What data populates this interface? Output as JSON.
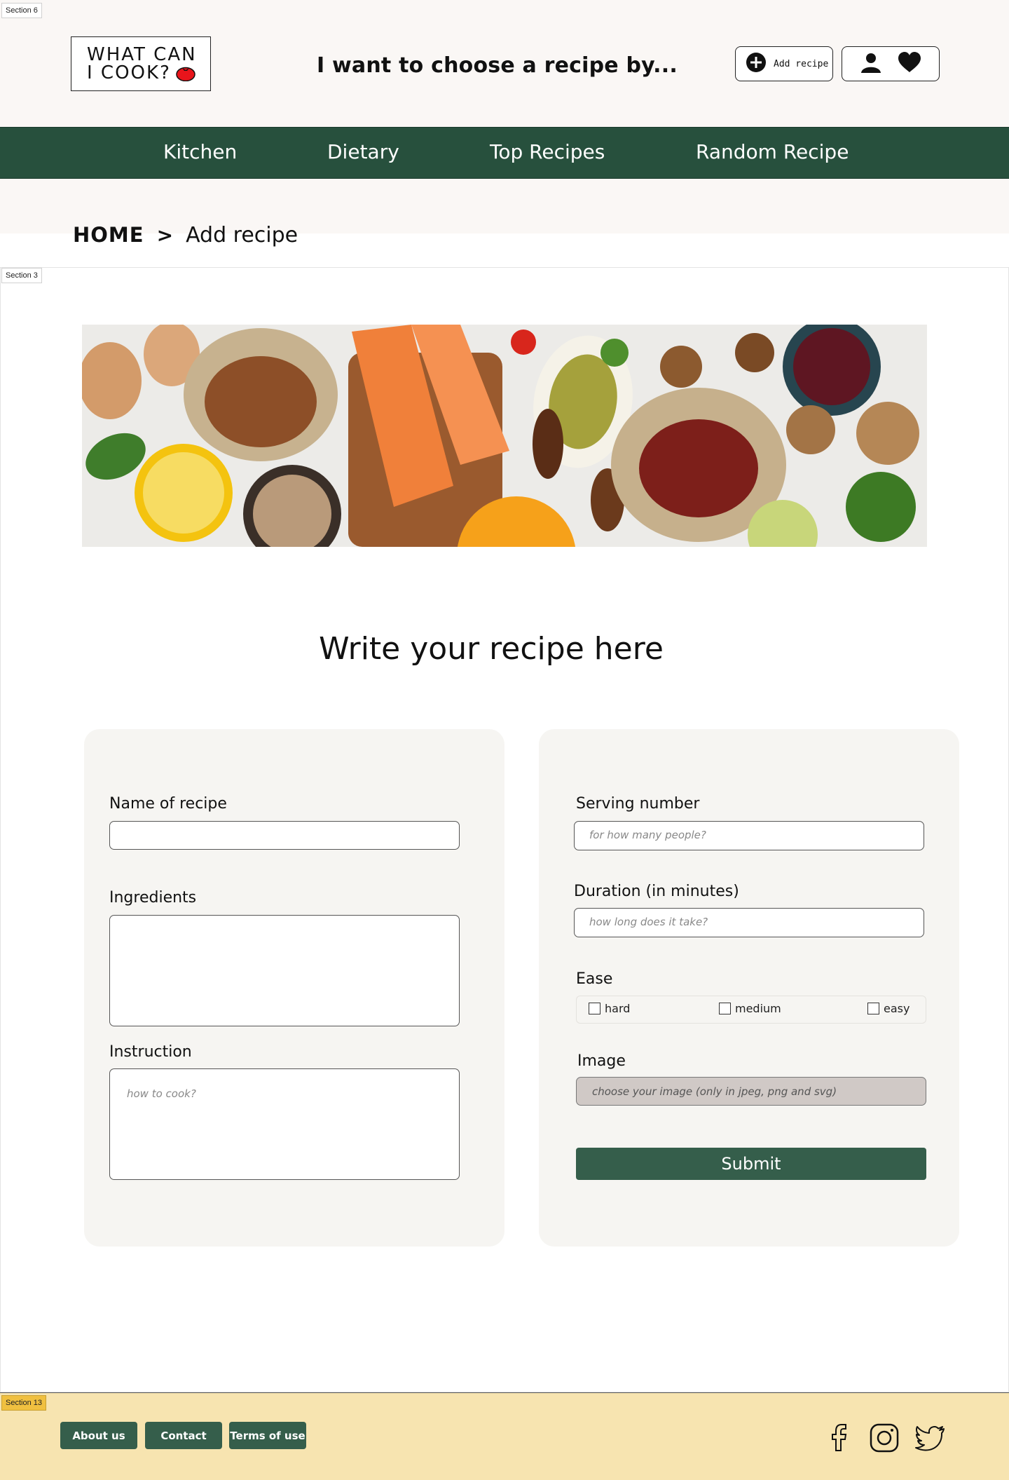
{
  "sections": {
    "header": "Section 6",
    "main": "Section 3",
    "footer": "Section 13"
  },
  "header": {
    "logo_line1": "WHAT CAN",
    "logo_line2": "I COOK?",
    "tagline": "I want to choose a recipe by...",
    "add_recipe_label": "Add recipe",
    "icons": [
      "plus-circle-icon",
      "user-icon",
      "heart-icon"
    ]
  },
  "nav": {
    "items": [
      "Kitchen",
      "Dietary",
      "Top Recipes",
      "Random Recipe"
    ]
  },
  "breadcrumb": {
    "home": "HOME",
    "separator": ">",
    "current": "Add recipe"
  },
  "form": {
    "title": "Write your recipe here",
    "name_label": "Name of recipe",
    "name_value": "",
    "ingredients_label": "Ingredients",
    "instruction_label": "Instruction",
    "instruction_placeholder": "how to cook?",
    "serving_label": "Serving number",
    "serving_placeholder": "for how many people?",
    "duration_label": "Duration (in minutes)",
    "duration_placeholder": "how long does it take?",
    "ease_label": "Ease",
    "ease_options": [
      "hard",
      "medium",
      "easy"
    ],
    "image_label": "Image",
    "image_placeholder": "choose your image (only in jpeg, png and svg)",
    "submit_label": "Submit"
  },
  "footer": {
    "links": [
      "About us",
      "Contact",
      "Terms of use"
    ],
    "social": [
      "facebook-icon",
      "instagram-icon",
      "twitter-icon"
    ]
  },
  "colors": {
    "brand_green": "#27503d",
    "button_green": "#355e4b",
    "footer_bg": "#f7e4b0",
    "panel_bg": "#f6f5f2",
    "tomato": "#e8141b"
  }
}
